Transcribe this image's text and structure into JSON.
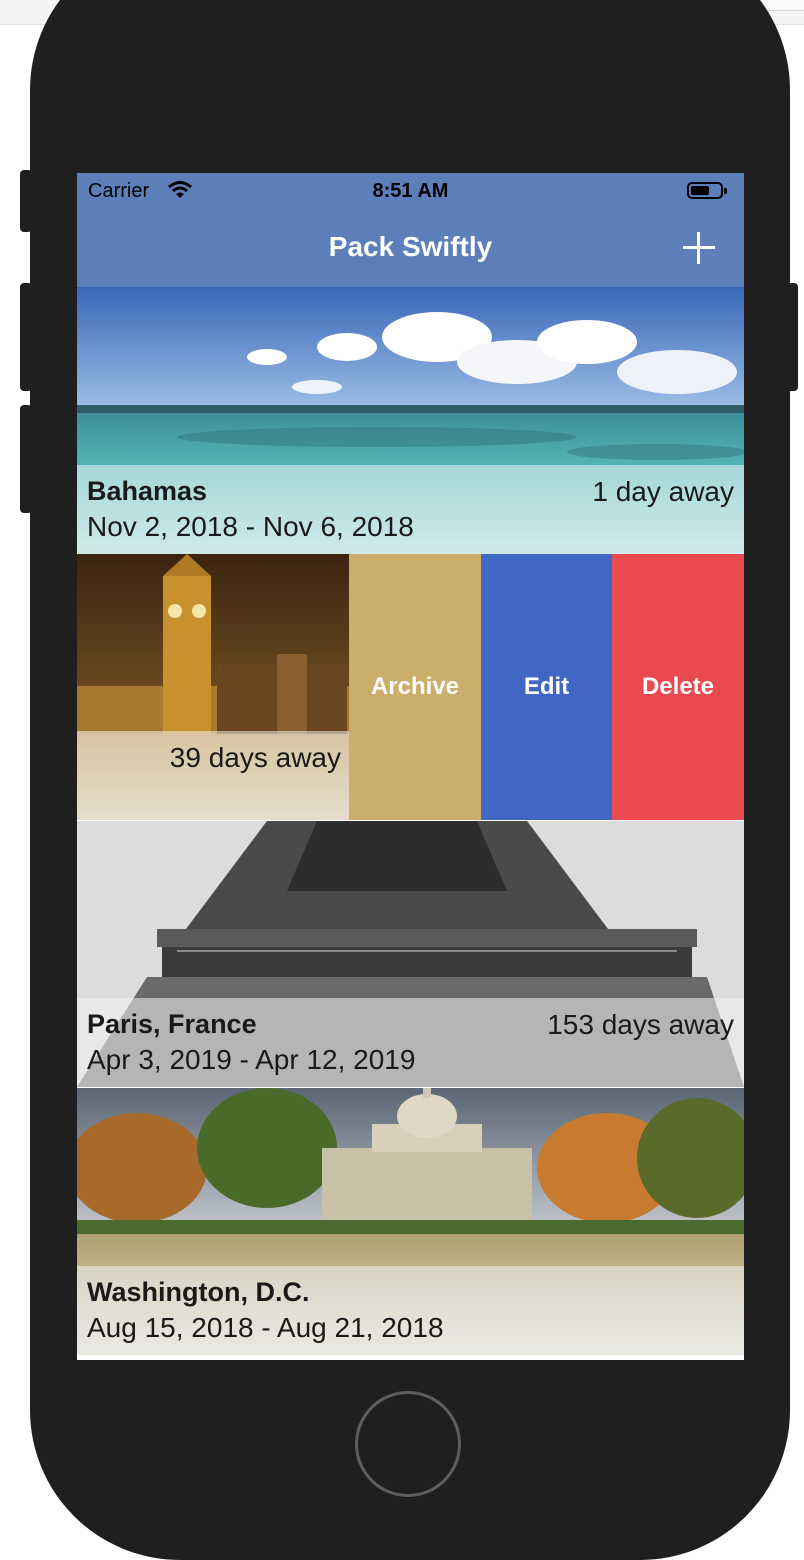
{
  "status_bar": {
    "carrier": "Carrier",
    "time": "8:51 AM"
  },
  "nav": {
    "title": "Pack Swiftly",
    "add_icon": "plus-icon"
  },
  "trips": [
    {
      "place": "Bahamas",
      "dates": "Nov 2, 2018 - Nov 6, 2018",
      "away": "1 day away"
    },
    {
      "place": "",
      "dates": "",
      "away": "39 days away"
    },
    {
      "place": "Paris, France",
      "dates": "Apr 3, 2019 - Apr 12, 2019",
      "away": "153 days away"
    },
    {
      "place": "Washington, D.C.",
      "dates": "Aug 15, 2018 - Aug 21, 2018",
      "away": ""
    }
  ],
  "swipe_actions": [
    {
      "label": "Archive",
      "color": "#cbad6c"
    },
    {
      "label": "Edit",
      "color": "#4266c3"
    },
    {
      "label": "Delete",
      "color": "#ea4a4f"
    }
  ],
  "colors": {
    "nav_bar": "#5d7fb9",
    "device": "#1f1f1f"
  }
}
